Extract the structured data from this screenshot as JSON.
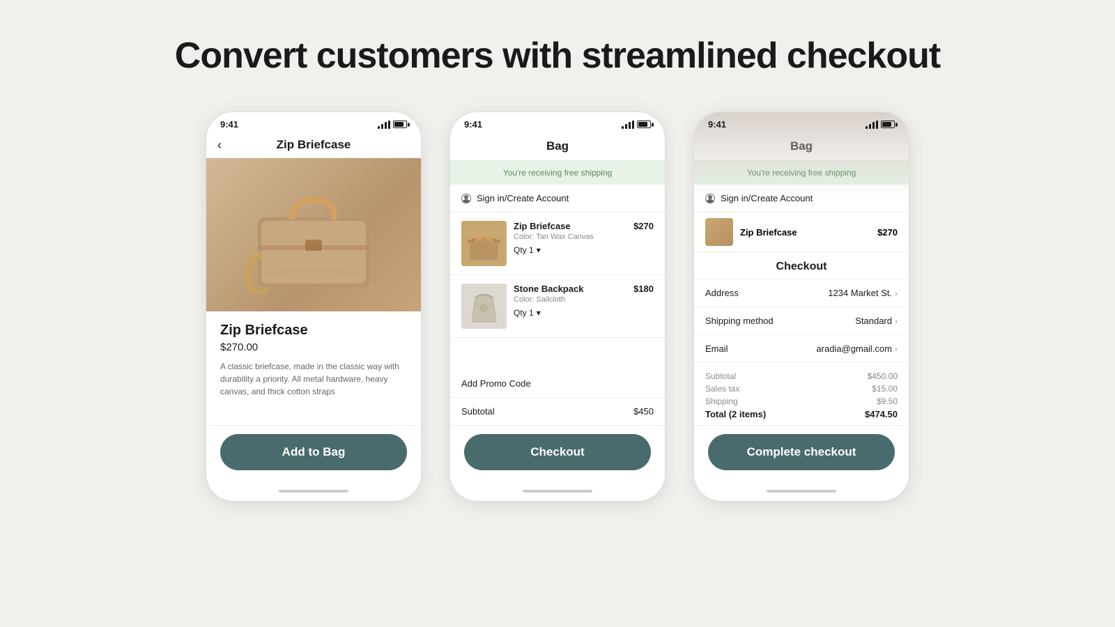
{
  "page": {
    "headline": "Convert customers with streamlined checkout",
    "background_color": "#f0f0ed"
  },
  "phones": [
    {
      "id": "phone-product",
      "status_time": "9:41",
      "nav_back": "‹",
      "nav_title": "Zip Briefcase",
      "product_name": "Zip Briefcase",
      "product_price": "$270.00",
      "product_description": "A classic briefcase, made in the classic way with durability a priority. All metal hardware, heavy canvas, and thick cotton straps",
      "cta_label": "Add to Bag"
    },
    {
      "id": "phone-bag",
      "status_time": "9:41",
      "screen_title": "Bag",
      "free_shipping_text": "You're receiving free shipping",
      "sign_in_label": "Sign in/Create Account",
      "items": [
        {
          "name": "Zip Briefcase",
          "color": "Color: Tan Wax Canvas",
          "price": "$270",
          "qty": "Qty 1"
        },
        {
          "name": "Stone Backpack",
          "color": "Color: Sailcloth",
          "price": "$180",
          "qty": "Qty 1"
        }
      ],
      "promo_label": "Add Promo Code",
      "subtotal_label": "Subtotal",
      "subtotal_value": "$450",
      "cta_label": "Checkout"
    },
    {
      "id": "phone-checkout",
      "status_time": "9:41",
      "screen_title": "Bag",
      "free_shipping_text": "You're receiving free shipping",
      "sign_in_label": "Sign in/Create Account",
      "cart_item_name": "Zip Briefcase",
      "cart_item_price": "$270",
      "checkout_header": "Checkout",
      "rows": [
        {
          "label": "Address",
          "value": "1234 Market St."
        },
        {
          "label": "Shipping method",
          "value": "Standard"
        },
        {
          "label": "Email",
          "value": "aradia@gmail.com"
        }
      ],
      "totals": [
        {
          "label": "Subtotal",
          "value": "$450.00"
        },
        {
          "label": "Sales tax",
          "value": "$15.00"
        },
        {
          "label": "Shipping",
          "value": "$9.50"
        },
        {
          "label": "Total (2 items)",
          "value": "$474.50",
          "is_total": true
        }
      ],
      "cta_label": "Complete checkout"
    }
  ]
}
